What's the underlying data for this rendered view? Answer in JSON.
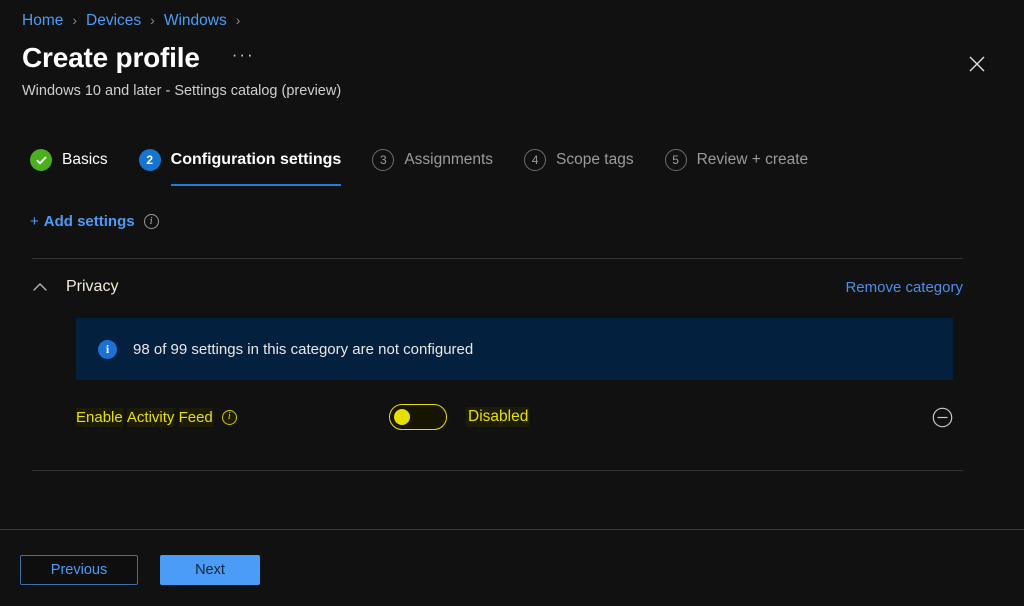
{
  "breadcrumb": {
    "items": [
      {
        "label": "Home"
      },
      {
        "label": "Devices"
      },
      {
        "label": "Windows"
      }
    ],
    "separator": "›"
  },
  "header": {
    "title": "Create profile",
    "subtitle": "Windows 10 and later - Settings catalog (preview)",
    "more_label": "···",
    "close_label": "✕"
  },
  "steps": [
    {
      "number": "✓",
      "label": "Basics",
      "state": "done"
    },
    {
      "number": "2",
      "label": "Configuration settings",
      "state": "active"
    },
    {
      "number": "3",
      "label": "Assignments",
      "state": "idle"
    },
    {
      "number": "4",
      "label": "Scope tags",
      "state": "idle"
    },
    {
      "number": "5",
      "label": "Review + create",
      "state": "idle"
    }
  ],
  "toolbar": {
    "add_settings_plus": "+",
    "add_settings_label": "Add settings",
    "info_glyph": "i"
  },
  "category": {
    "title": "Privacy",
    "remove_label": "Remove category",
    "collapse_state": "expanded"
  },
  "banner": {
    "icon_glyph": "i",
    "text": "98 of 99 settings in this category are not configured",
    "configured_count": 98,
    "total_count": 99
  },
  "setting": {
    "name_part1": "Enable",
    "name_part2": "Activity",
    "name_part3": "Feed",
    "info_glyph": "i",
    "toggle_state": "off",
    "toggle_label": "Disabled"
  },
  "footer": {
    "previous_label": "Previous",
    "next_label": "Next"
  },
  "colors": {
    "page_background": "#111111",
    "link_blue": "#4a9cf6",
    "accent_blue": "#1675d1",
    "success_green": "#4caf1f",
    "banner_background": "#04203f",
    "highlight_yellow": "#e6e000",
    "primary_button": "#4a9cf6",
    "divider": "#333333"
  }
}
